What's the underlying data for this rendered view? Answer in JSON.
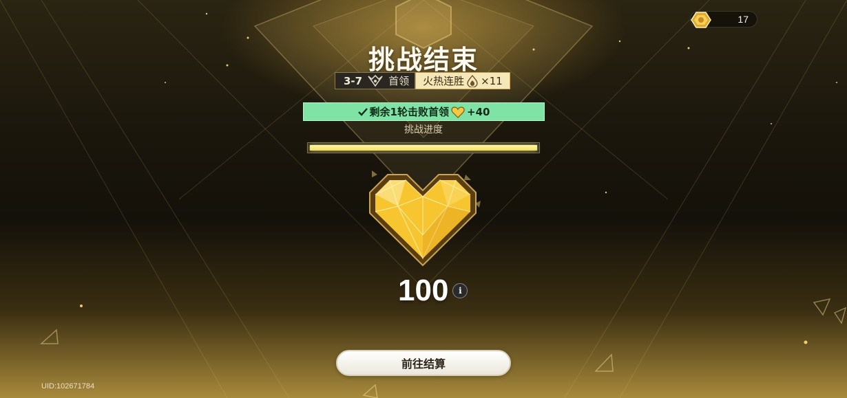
{
  "currency": {
    "icon": "token-coin-icon",
    "value": "17"
  },
  "title": "挑战结束",
  "stage": {
    "code": "3-7",
    "icon": "boss-rank-icon",
    "type": "首领"
  },
  "streak": {
    "label": "火热连胜",
    "icon": "flame-drop-icon",
    "count": "×11"
  },
  "banner": {
    "check_icon": "check-icon",
    "text": "剩余1轮击败首领",
    "heart_icon": "heart-icon",
    "bonus": "+40"
  },
  "progress": {
    "label": "挑战进度",
    "value": 1.0
  },
  "score": {
    "value": "100",
    "info_icon": "info-icon",
    "info_glyph": "i"
  },
  "settle_button": "前往结算",
  "uid": "UID:102671784",
  "colors": {
    "banner": "#7fe3a6",
    "accent_gold": "#f2c233",
    "progress": "#f2e05a"
  }
}
